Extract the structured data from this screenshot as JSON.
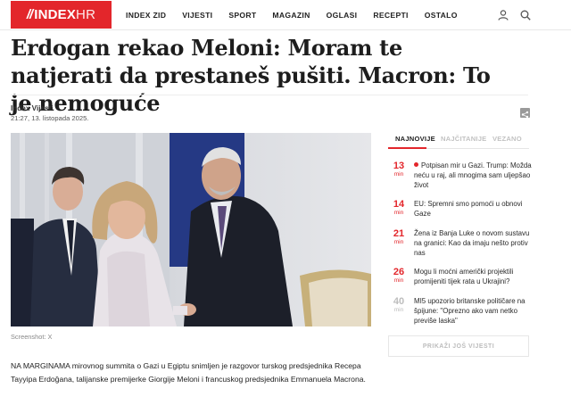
{
  "header": {
    "logo": {
      "mark": "//",
      "brand": "INDEX",
      "suffix": "HR"
    },
    "nav": [
      "INDEX ZID",
      "VIJESTI",
      "SPORT",
      "MAGAZIN",
      "OGLASI",
      "RECEPTI",
      "OSTALO"
    ],
    "icons": [
      "user-icon",
      "search-icon"
    ]
  },
  "article": {
    "title": "Erdogan rekao Meloni: Moram te natjerati da prestaneš pušiti. Macron: To je nemoguće",
    "author": "Index Vijesti",
    "date": "21:27, 13. listopada 2025.",
    "photo_credit": "Screenshot: X",
    "lead": "NA MARGINAMA mirovnog summita o Gazi u Egiptu snimljen je razgovor turskog predsjednika Recepa Tayyipa Erdoğana, talijanske premijerke Giorgije Meloni i francuskog predsjednika Emmanuela Macrona."
  },
  "sidebar": {
    "tabs": [
      "NAJNOVIJE",
      "NAJČITANIJE",
      "VEZANO"
    ],
    "min_label": "min",
    "items": [
      {
        "minutes": "13",
        "text": "Potpisan mir u Gazi. Trump: Možda neću u raj, ali mnogima sam uljepšao život"
      },
      {
        "minutes": "14",
        "text": "EU: Spremni smo pomoći u obnovi Gaze"
      },
      {
        "minutes": "21",
        "text": "Žena iz Banja Luke o novom sustavu na granici: Kao da imaju nešto protiv nas"
      },
      {
        "minutes": "26",
        "text": "Mogu li moćni američki projektili promijeniti tijek rata u Ukrajini?"
      },
      {
        "minutes": "40",
        "text": "MI5 upozorio britanske političare na špijune: \"Oprezno ako vam netko previše laska\""
      }
    ],
    "more_button": "PRIKAŽI JOŠ VIJESTI"
  },
  "colors": {
    "brand": "#e3262b",
    "text": "#222222",
    "muted": "#bdbdbd"
  }
}
